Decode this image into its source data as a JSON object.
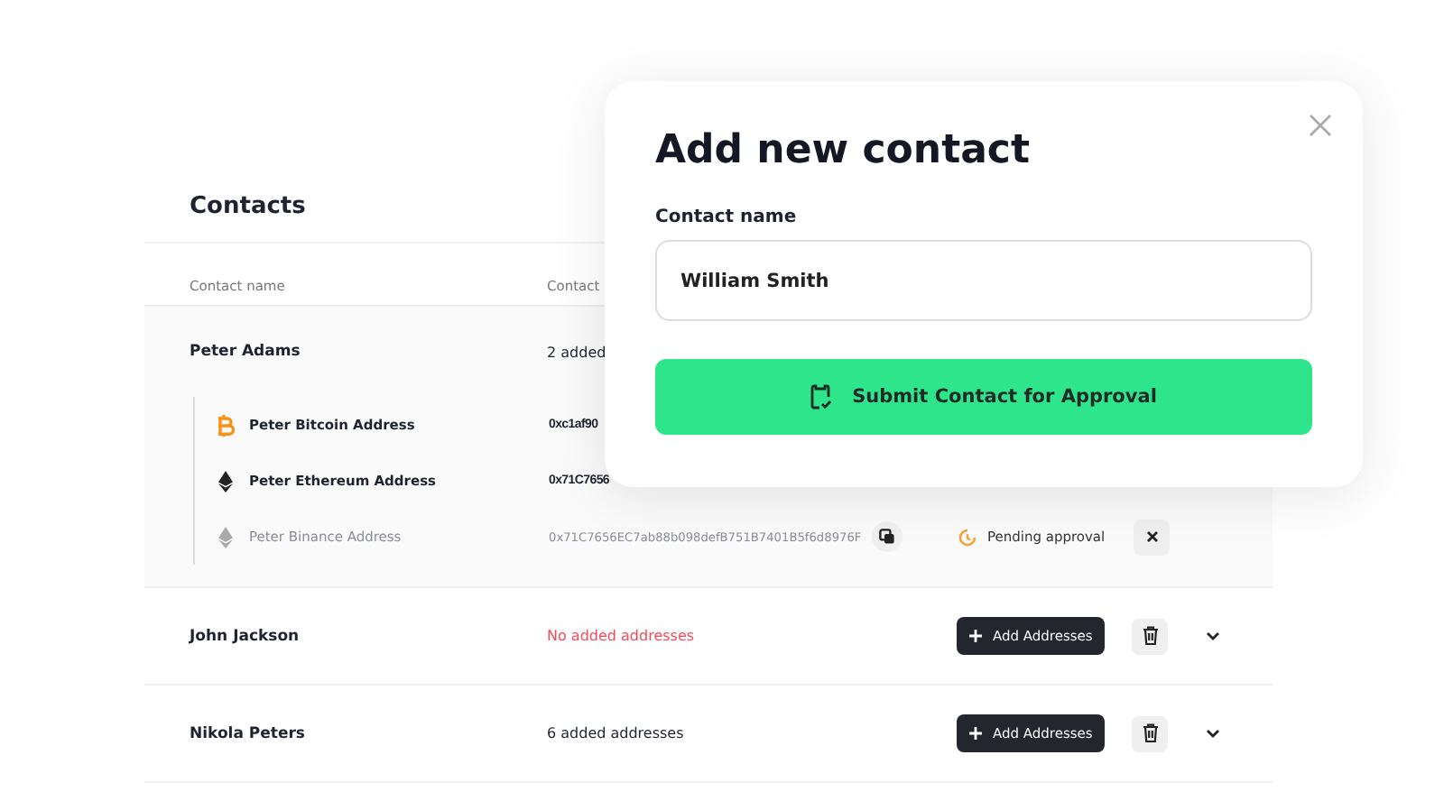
{
  "contacts": {
    "title": "Contacts",
    "columns": [
      "Contact name",
      "Contact"
    ],
    "rows": [
      {
        "name": "Peter Adams",
        "summary": "2 added",
        "empty": false,
        "expanded": true,
        "addresses": [
          {
            "kind": "bitcoin",
            "name": "Peter Bitcoin Address",
            "address": "0xc1af90",
            "pending": false
          },
          {
            "kind": "ethereum",
            "name": "Peter Ethereum Address",
            "address": "0x71C7656",
            "pending": false
          },
          {
            "kind": "ethereum",
            "name": "Peter Binance Address",
            "address": "0x71C7656EC7ab88b098defB751B7401B5f6d8976F",
            "pending": true,
            "status": "Pending approval"
          }
        ]
      },
      {
        "name": "John Jackson",
        "summary": "No added addresses",
        "empty": true,
        "expanded": false,
        "action": "Add Addresses"
      },
      {
        "name": "Nikola Peters",
        "summary": "6 added addresses",
        "empty": false,
        "expanded": false,
        "action": "Add Addresses"
      }
    ]
  },
  "dialog": {
    "title": "Add new contact",
    "field_label": "Contact name",
    "field_value": "William Smith",
    "submit": "Submit Contact for Approval"
  }
}
